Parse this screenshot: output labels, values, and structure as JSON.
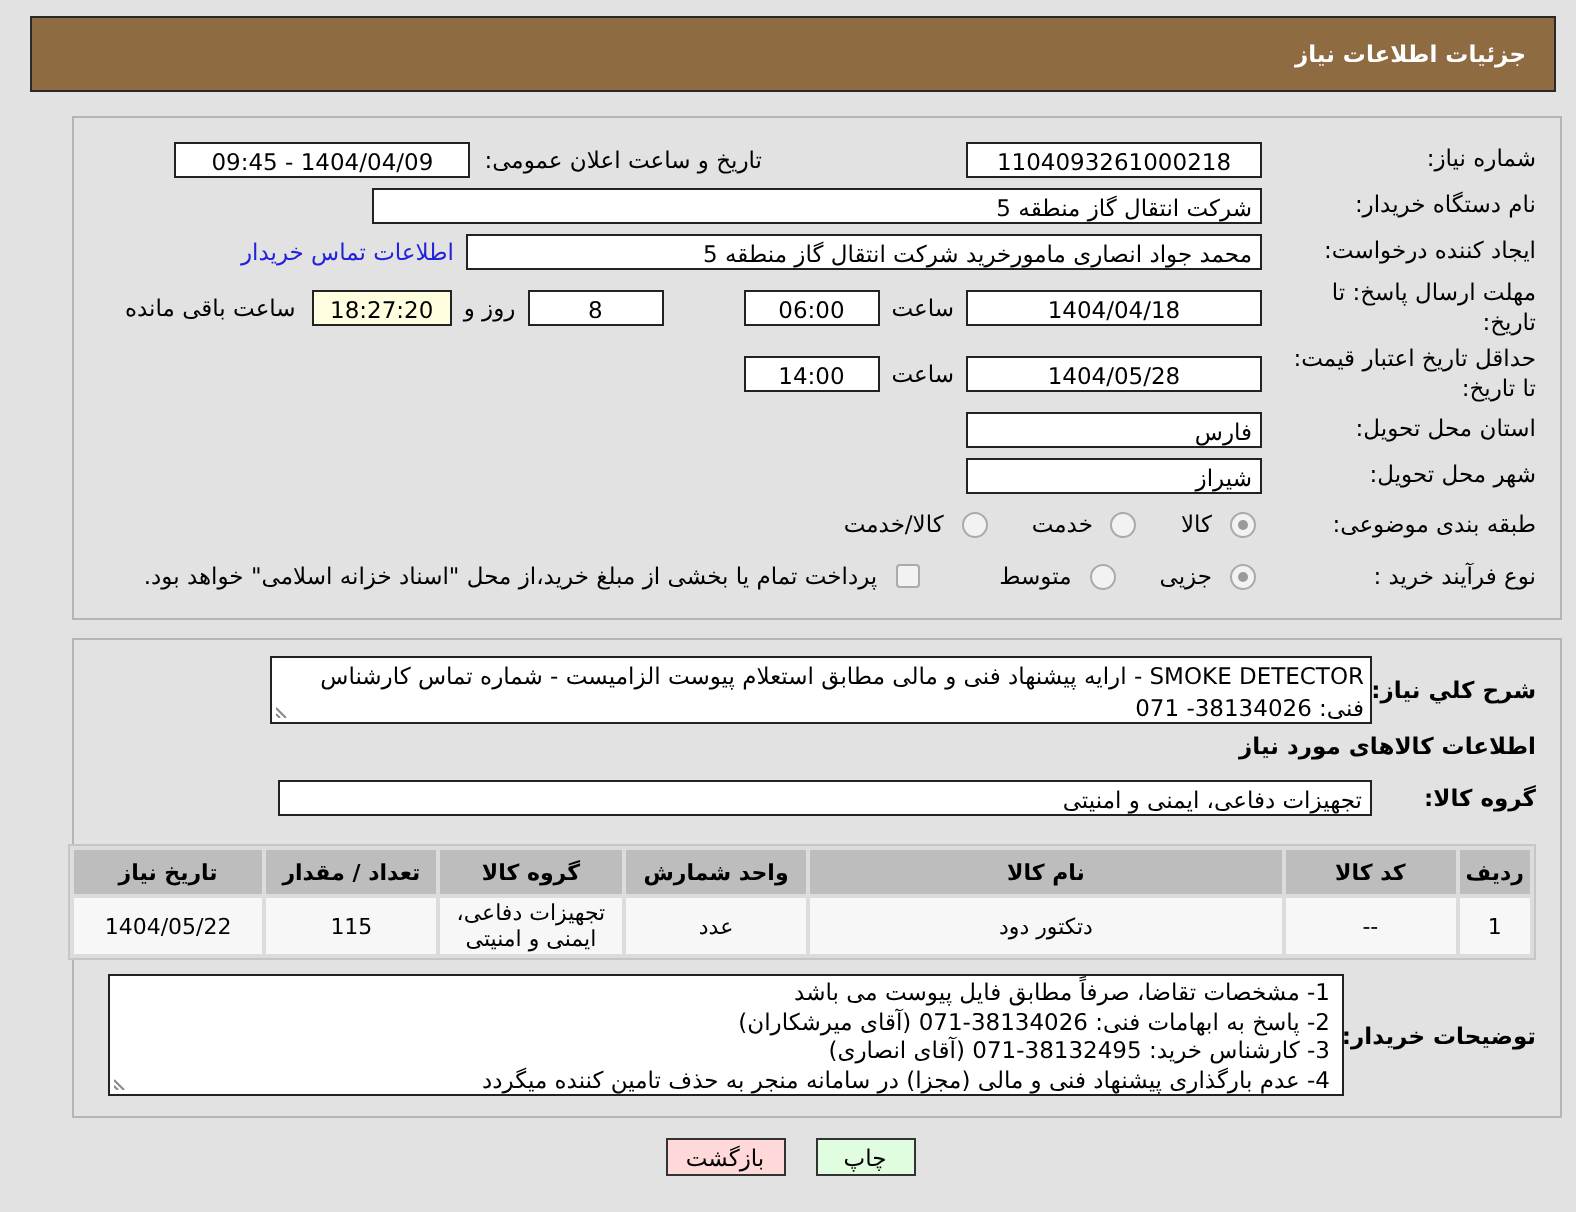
{
  "header": {
    "title": "جزئیات اطلاعات نیاز"
  },
  "need_number": {
    "label": "شماره نیاز:",
    "value": "1104093261000218"
  },
  "announce": {
    "label": "تاریخ و ساعت اعلان عمومی:",
    "value": "1404/04/09 - 09:45"
  },
  "buyer_org": {
    "label": "نام دستگاه خریدار:",
    "value": "شرکت انتقال گاز منطقه 5"
  },
  "requester": {
    "label": "ایجاد کننده درخواست:",
    "value": "محمد جواد انصاری مامورخرید شرکت انتقال گاز منطقه 5",
    "link": "اطلاعات تماس خریدار"
  },
  "deadline": {
    "label": "مهلت ارسال پاسخ: تا تاریخ:",
    "date": "1404/04/18",
    "time_label": "ساعت",
    "time": "06:00",
    "days": "8",
    "days_label": "روز و",
    "remaining": "18:27:20",
    "remaining_label": "ساعت باقی مانده"
  },
  "validity": {
    "label": "حداقل تاریخ اعتبار قیمت: تا تاریخ:",
    "date": "1404/05/28",
    "time_label": "ساعت",
    "time": "14:00"
  },
  "province": {
    "label": "استان محل تحویل:",
    "value": "فارس"
  },
  "city": {
    "label": "شهر محل تحویل:",
    "value": "شیراز"
  },
  "category": {
    "label": "طبقه بندی موضوعی:",
    "options": [
      {
        "label": "کالا",
        "selected": true
      },
      {
        "label": "خدمت",
        "selected": false
      },
      {
        "label": "کالا/خدمت",
        "selected": false
      }
    ]
  },
  "process": {
    "label": "نوع فرآیند خرید :",
    "options": [
      {
        "label": "جزیی",
        "selected": true
      },
      {
        "label": "متوسط",
        "selected": false
      }
    ],
    "treasury": {
      "label": "پرداخت تمام یا بخشی از مبلغ خرید،از محل \"اسناد خزانه اسلامی\" خواهد بود.",
      "checked": false
    }
  },
  "description": {
    "label": "شرح کلي نياز:",
    "value": "SMOKE DETECTOR - ارایه پیشنهاد فنی و مالی مطابق استعلام پیوست الزامیست - شماره تماس کارشناس فنی: 38134026- 071"
  },
  "goods": {
    "heading": "اطلاعات کالاهای مورد نیاز",
    "group_label": "گروه کالا:",
    "group": "تجهیزات دفاعی، ایمنی و امنیتی",
    "table": {
      "columns": [
        "ردیف",
        "کد کالا",
        "نام کالا",
        "واحد شمارش",
        "گروه کالا",
        "تعداد / مقدار",
        "تاریخ نیاز"
      ],
      "rows": [
        [
          "1",
          "--",
          "دتکتور دود",
          "عدد",
          "تجهیزات دفاعی، ایمنی و امنیتی",
          "115",
          "1404/05/22"
        ]
      ]
    }
  },
  "buyer_notes": {
    "label": "توضیحات خریدار:",
    "lines": [
      "1-  مشخصات تقاضا، صرفاً مطابق فایل پیوست می باشد",
      "2- پاسخ به ابهامات فنی: 38134026-071 (آقای میرشکاران)",
      "3- کارشناس خرید: 38132495-071 (آقای انصاری)",
      "4- عدم بارگذاری پیشنهاد فنی و مالی (مجزا) در سامانه منجر به حذف تامین کننده میگردد"
    ]
  },
  "buttons": [
    {
      "label": "چاپ",
      "kind": "print"
    },
    {
      "label": "بازگشت",
      "kind": "back"
    }
  ]
}
